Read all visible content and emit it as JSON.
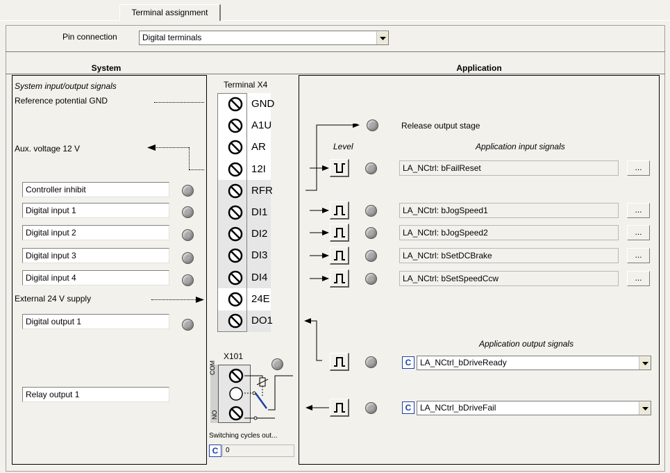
{
  "tab": {
    "label": "Terminal assignment"
  },
  "pin_connection": {
    "label": "Pin connection",
    "value": "Digital terminals"
  },
  "system": {
    "title": "System",
    "subtitle": "System input/output signals",
    "ref_gnd": "Reference potential GND",
    "aux_voltage": "Aux. voltage 12 V",
    "ext_supply": "External 24 V supply",
    "inputs": [
      "Controller inhibit",
      "Digital input 1",
      "Digital input 2",
      "Digital input 3",
      "Digital input 4"
    ],
    "digital_output": "Digital output 1",
    "relay_output": "Relay output 1"
  },
  "terminal": {
    "title": "Terminal  X4",
    "labels": [
      "GND",
      "A1U",
      "AR",
      "12I",
      "RFR",
      "DI1",
      "DI2",
      "DI3",
      "DI4",
      "24E",
      "DO1"
    ],
    "x101": "X101",
    "relay_labels": [
      "COM",
      "NO"
    ],
    "switching_label": "Switching cycles out...",
    "switching_value": "0"
  },
  "application": {
    "title": "Application",
    "release_output": "Release output stage",
    "level_label": "Level",
    "input_signals_title": "Application input signals",
    "input_signals": [
      "LA_NCtrl: bFailReset",
      "LA_NCtrl: bJogSpeed1",
      "LA_NCtrl: bJogSpeed2",
      "LA_NCtrl: bSetDCBrake",
      "LA_NCtrl: bSetSpeedCcw"
    ],
    "ellipsis": "...",
    "output_signals_title": "Application output signals",
    "output_signals": [
      "LA_NCtrl_bDriveReady",
      "LA_NCtrl_bDriveFail"
    ],
    "c_label": "C"
  },
  "colors": {
    "background": "#f2f1ec",
    "led": "#a9a9a9",
    "accent": "#1c3fa8"
  }
}
